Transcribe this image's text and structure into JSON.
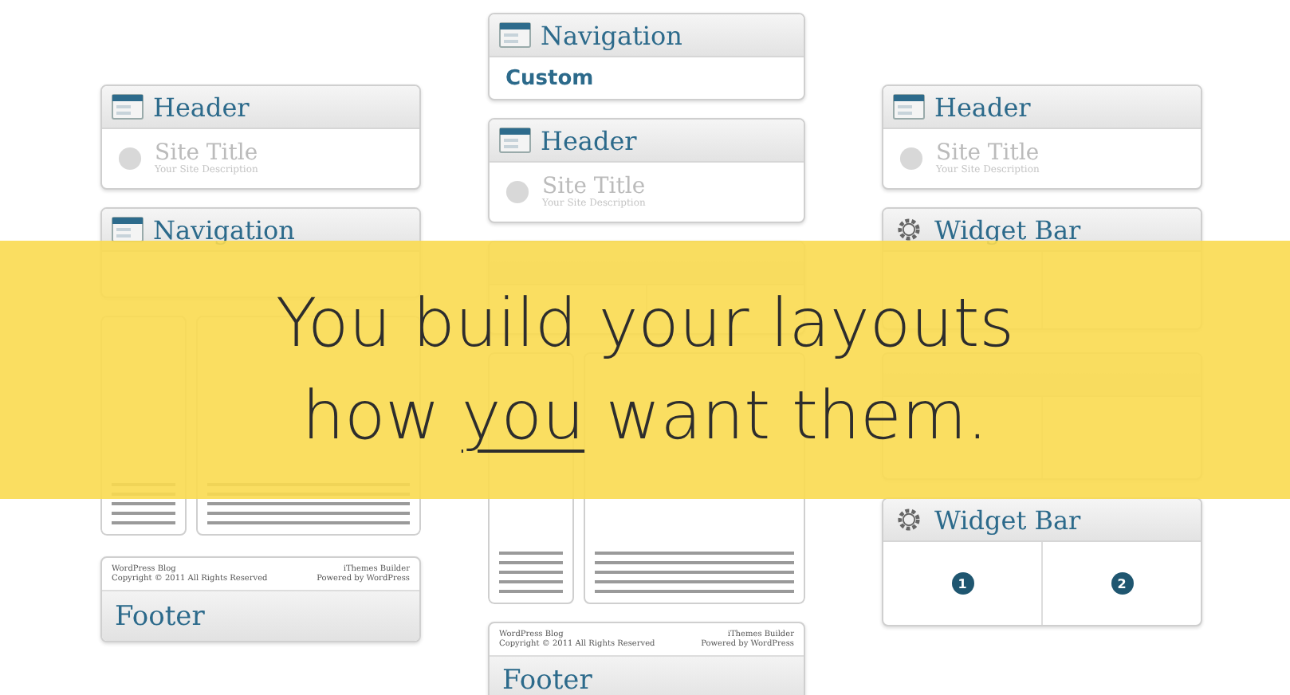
{
  "columns": [
    {
      "modules": [
        {
          "kind": "header",
          "title": "Header",
          "site_title": "Site Title",
          "description": "Your Site Description"
        },
        {
          "kind": "navigation",
          "title": "Navigation"
        },
        {
          "kind": "columns"
        },
        {
          "kind": "footer",
          "title": "Footer",
          "blog": "WordPress Blog",
          "copyright": "Copyright © 2011 All Rights Reserved",
          "builder": "iThemes Builder",
          "powered": "Powered by WordPress"
        }
      ]
    },
    {
      "modules": [
        {
          "kind": "navigation",
          "title": "Navigation",
          "menu": "Custom"
        },
        {
          "kind": "header",
          "title": "Header",
          "site_title": "Site Title",
          "description": "Your Site Description"
        },
        {
          "kind": "widgets"
        },
        {
          "kind": "columns"
        },
        {
          "kind": "footer",
          "title": "Footer",
          "blog": "WordPress Blog",
          "copyright": "Copyright © 2011 All Rights Reserved",
          "builder": "iThemes Builder",
          "powered": "Powered by WordPress"
        }
      ]
    },
    {
      "modules": [
        {
          "kind": "header",
          "title": "Header",
          "site_title": "Site Title",
          "description": "Your Site Description"
        },
        {
          "kind": "widgets",
          "title": "Widget Bar"
        },
        {
          "kind": "widgets"
        },
        {
          "kind": "widgets",
          "title": "Widget Bar",
          "numbers": [
            "1",
            "2"
          ]
        }
      ]
    }
  ],
  "banner": {
    "line_1": "You build your layouts",
    "line_2": [
      {
        "text": "how ",
        "underlined": false
      },
      {
        "text": "you",
        "underlined": true
      },
      {
        "text": " want them.",
        "underlined": false
      }
    ]
  }
}
